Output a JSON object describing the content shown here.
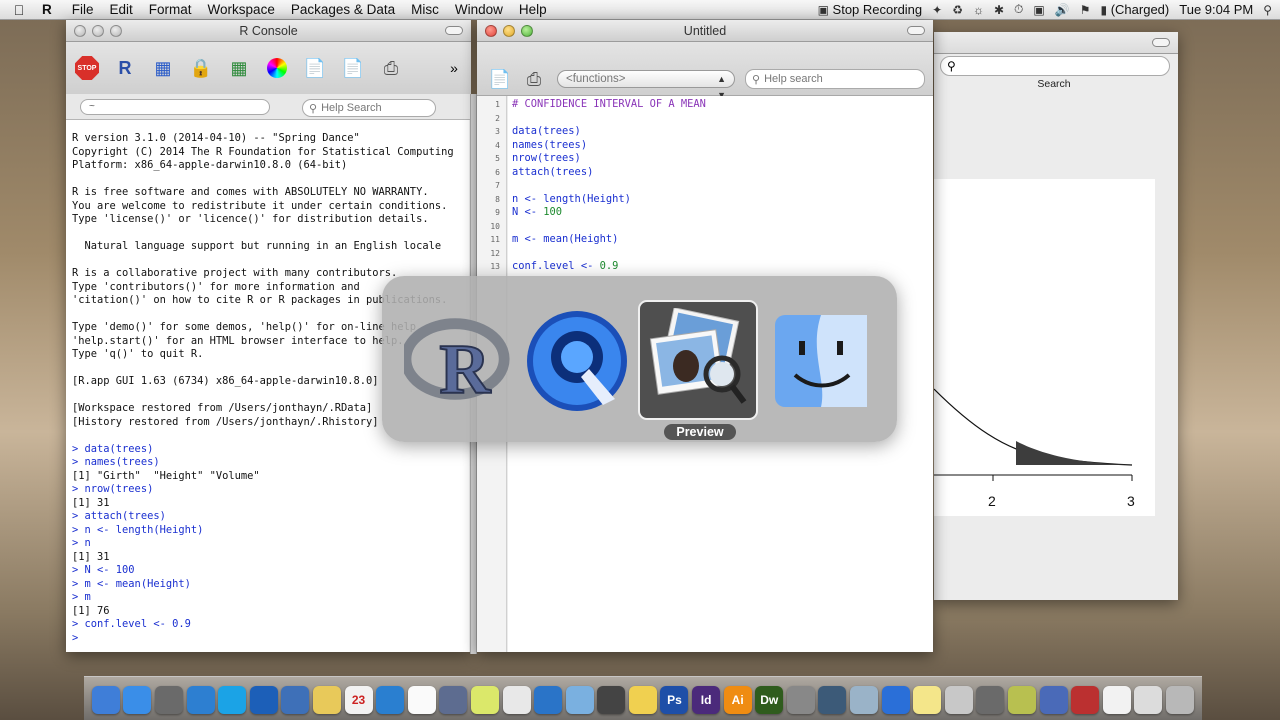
{
  "menubar": {
    "apple_icon": "apple-icon",
    "app_name": "R",
    "items": [
      "File",
      "Edit",
      "Format",
      "Workspace",
      "Packages & Data",
      "Misc",
      "Window",
      "Help"
    ],
    "stop_recording": "Stop Recording",
    "battery": "(Charged)",
    "clock": "Tue 9:04 PM"
  },
  "console": {
    "title": "R Console",
    "path_placeholder": "~",
    "search_placeholder": "Help Search",
    "lines": [
      {
        "t": "R version 3.1.0 (2014-04-10) -- \"Spring Dance\"",
        "k": "out"
      },
      {
        "t": "Copyright (C) 2014 The R Foundation for Statistical Computing",
        "k": "out"
      },
      {
        "t": "Platform: x86_64-apple-darwin10.8.0 (64-bit)",
        "k": "out"
      },
      {
        "t": "",
        "k": "out"
      },
      {
        "t": "R is free software and comes with ABSOLUTELY NO WARRANTY.",
        "k": "out"
      },
      {
        "t": "You are welcome to redistribute it under certain conditions.",
        "k": "out"
      },
      {
        "t": "Type 'license()' or 'licence()' for distribution details.",
        "k": "out"
      },
      {
        "t": "",
        "k": "out"
      },
      {
        "t": "  Natural language support but running in an English locale",
        "k": "out"
      },
      {
        "t": "",
        "k": "out"
      },
      {
        "t": "R is a collaborative project with many contributors.",
        "k": "out"
      },
      {
        "t": "Type 'contributors()' for more information and",
        "k": "out"
      },
      {
        "t": "'citation()' on how to cite R or R packages in publications.",
        "k": "out"
      },
      {
        "t": "",
        "k": "out"
      },
      {
        "t": "Type 'demo()' for some demos, 'help()' for on-line help, or",
        "k": "out"
      },
      {
        "t": "'help.start()' for an HTML browser interface to help.",
        "k": "out"
      },
      {
        "t": "Type 'q()' to quit R.",
        "k": "out"
      },
      {
        "t": "",
        "k": "out"
      },
      {
        "t": "[R.app GUI 1.63 (6734) x86_64-apple-darwin10.8.0]",
        "k": "out"
      },
      {
        "t": "",
        "k": "out"
      },
      {
        "t": "[Workspace restored from /Users/jonthayn/.RData]",
        "k": "out"
      },
      {
        "t": "[History restored from /Users/jonthayn/.Rhistory]",
        "k": "out"
      },
      {
        "t": "",
        "k": "out"
      },
      {
        "t": "> data(trees)",
        "k": "prompt"
      },
      {
        "t": "> names(trees)",
        "k": "prompt"
      },
      {
        "t": "[1] \"Girth\"  \"Height\" \"Volume\"",
        "k": "out"
      },
      {
        "t": "> nrow(trees)",
        "k": "prompt"
      },
      {
        "t": "[1] 31",
        "k": "out"
      },
      {
        "t": "> attach(trees)",
        "k": "prompt"
      },
      {
        "t": "> n <- length(Height)",
        "k": "prompt"
      },
      {
        "t": "> n",
        "k": "prompt"
      },
      {
        "t": "[1] 31",
        "k": "out"
      },
      {
        "t": "> N <- 100",
        "k": "prompt"
      },
      {
        "t": "> m <- mean(Height)",
        "k": "prompt"
      },
      {
        "t": "> m",
        "k": "prompt"
      },
      {
        "t": "[1] 76",
        "k": "out"
      },
      {
        "t": "> conf.level <- 0.9",
        "k": "prompt"
      },
      {
        "t": ">",
        "k": "prompt"
      }
    ]
  },
  "editor": {
    "title": "Untitled",
    "functions_label": "<functions>",
    "search_placeholder": "Help search",
    "line_numbers": [
      "1",
      "2",
      "3",
      "4",
      "5",
      "6",
      "7",
      "8",
      "9",
      "10",
      "11",
      "12",
      "13"
    ],
    "code": [
      {
        "n": 1,
        "t": "# CONFIDENCE INTERVAL OF A MEAN",
        "k": "comment"
      },
      {
        "n": 2,
        "t": "",
        "k": "code"
      },
      {
        "n": 3,
        "t": "data(trees)",
        "k": "code"
      },
      {
        "n": 4,
        "t": "names(trees)",
        "k": "code"
      },
      {
        "n": 5,
        "t": "nrow(trees)",
        "k": "code"
      },
      {
        "n": 6,
        "t": "attach(trees)",
        "k": "code"
      },
      {
        "n": 7,
        "t": "",
        "k": "code"
      },
      {
        "n": 8,
        "t": "n <- length(Height)",
        "k": "code"
      },
      {
        "n": 9,
        "t": "N <- 100",
        "k": "num"
      },
      {
        "n": 10,
        "t": "",
        "k": "code"
      },
      {
        "n": 11,
        "t": "m <- mean(Height)",
        "k": "code"
      },
      {
        "n": 12,
        "t": "",
        "k": "code"
      },
      {
        "n": 13,
        "t": "conf.level <- 0.9",
        "k": "num"
      }
    ]
  },
  "help_window": {
    "search_label": "Search",
    "axis_ticks": [
      "2",
      "3"
    ]
  },
  "switcher": {
    "selected_label": "Preview",
    "apps": [
      "R",
      "QuickTime Player",
      "Preview",
      "Finder"
    ]
  },
  "dock": {
    "icons": [
      "finder-icon",
      "app-store-icon",
      "facetime-icon",
      "safari-icon",
      "skype-icon",
      "teamviewer-icon",
      "preview-icon",
      "notes-icon",
      "calendar-icon",
      "book-icon",
      "textedit-icon",
      "r-icon",
      "quicktime-icon",
      "mail-icon",
      "network-icon",
      "photos-icon",
      "bridge-icon",
      "flashlight-icon",
      "photoshop-icon",
      "indesign-icon",
      "illustrator-icon",
      "dreamweaver-icon",
      "chess-icon",
      "time-machine-icon",
      "image-capture-icon",
      "quicktime-x-icon",
      "stickies-icon",
      "trash-icon",
      "yen-icon",
      "utilities-icon",
      "scout-icon",
      "contacts-icon",
      "document-icon",
      "preview2-icon",
      "trash2-icon"
    ],
    "dock_labels": [
      "Ps",
      "Id",
      "Ai",
      "Dw",
      "23"
    ]
  },
  "colors": {
    "prompt_blue": "#1a2fd0",
    "comment_purple": "#8a35b8",
    "number_green": "#1d8a2e"
  }
}
